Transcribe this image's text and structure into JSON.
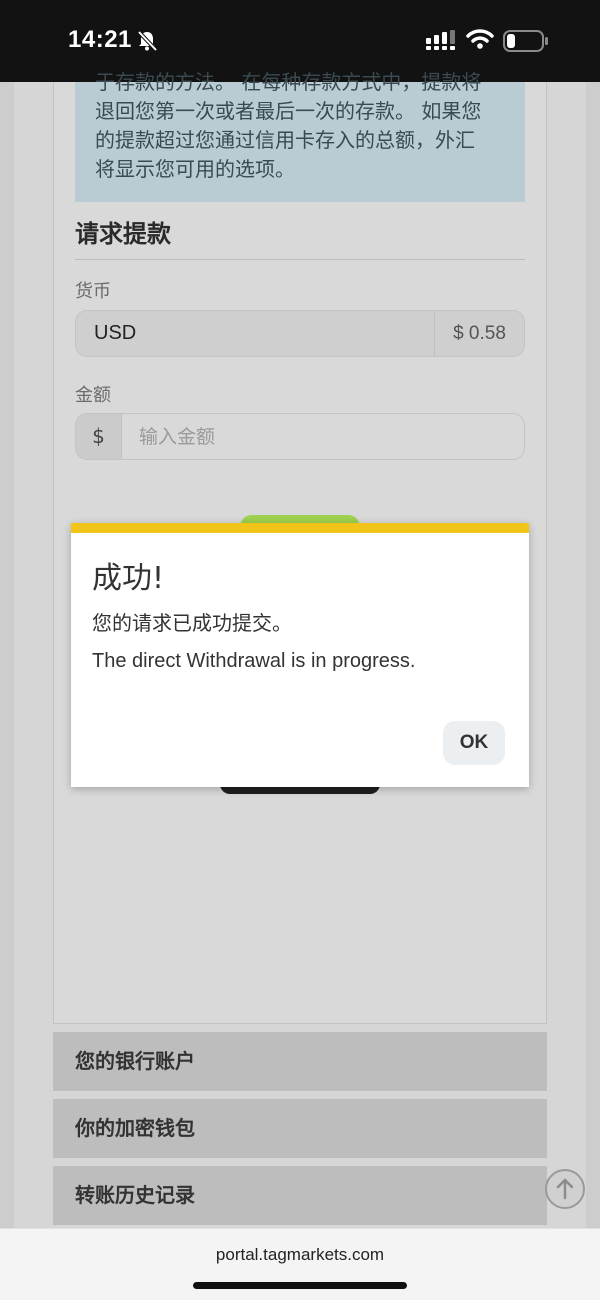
{
  "status_bar": {
    "time": "14:21",
    "icons": [
      "bell-slash-icon",
      "signal-icon",
      "wifi-icon",
      "battery-icon"
    ]
  },
  "info_box": {
    "lines": [
      "于存款的方法。 在每种存款方式中，提款将",
      "退回您第一次或者最后一次的存款。 如果您",
      "的提款超过您通过信用卡存入的总额，外汇",
      "将显示您可用的选项。"
    ]
  },
  "form": {
    "title": "请求提款",
    "currency_label": "货币",
    "currency_value": "USD",
    "balance": "$ 0.58",
    "amount_label": "金额",
    "amount_prefix": "$",
    "amount_placeholder": "输入金额"
  },
  "accordion": {
    "items": [
      "您的银行账户",
      "你的加密钱包",
      "转账历史记录"
    ]
  },
  "modal": {
    "title": "成功!",
    "message_zh": "您的请求已成功提交。",
    "message_en": "The direct Withdrawal is in progress.",
    "ok_label": "OK"
  },
  "browser": {
    "url": "portal.tagmarkets.com"
  },
  "colors": {
    "modal_accent": "#f0c419",
    "submit_button": "#9ed14f",
    "info_box_bg": "#b9cbd3"
  }
}
